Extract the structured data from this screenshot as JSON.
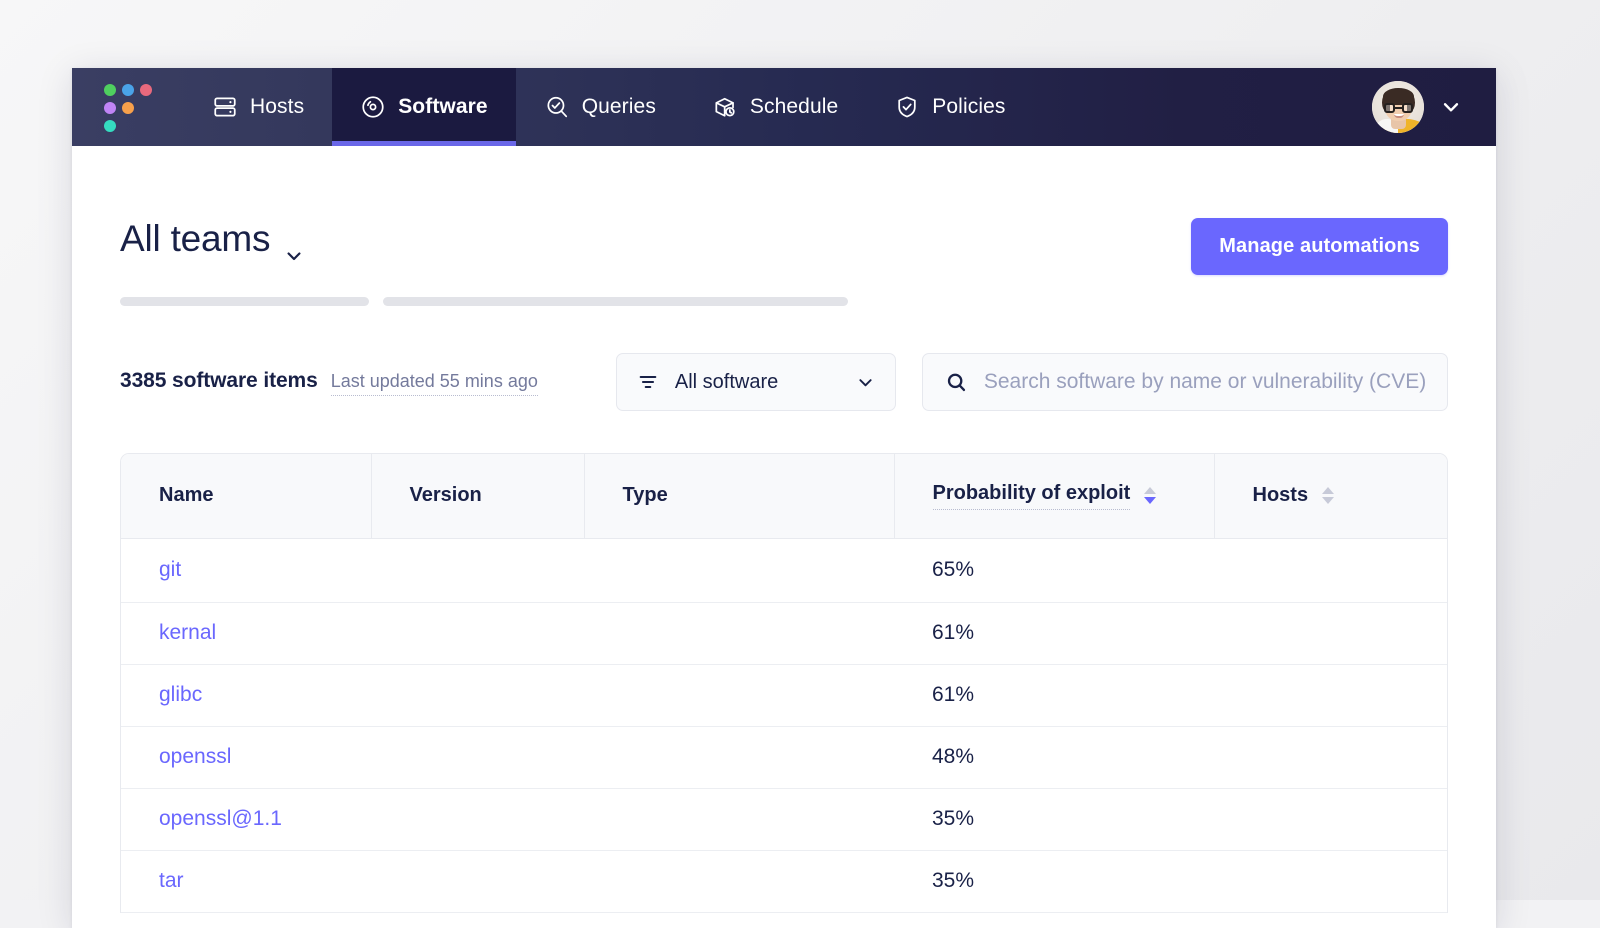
{
  "nav": {
    "logo_name": "fleet-logo",
    "items": [
      {
        "label": "Hosts",
        "icon": "server-icon",
        "active": false
      },
      {
        "label": "Software",
        "icon": "disc-icon",
        "active": true
      },
      {
        "label": "Queries",
        "icon": "search-check-icon",
        "active": false
      },
      {
        "label": "Schedule",
        "icon": "box-clock-icon",
        "active": false
      },
      {
        "label": "Policies",
        "icon": "shield-check-icon",
        "active": false
      }
    ],
    "avatar_alt": "user-avatar",
    "user_menu_icon": "chevron-down-icon"
  },
  "header": {
    "team_title": "All teams",
    "team_chevron_icon": "chevron-down-icon",
    "manage_automations_label": "Manage automations"
  },
  "toolbar": {
    "count_label": "3385 software items",
    "last_updated_label": "Last updated 55 mins ago",
    "filter": {
      "icon": "filter-icon",
      "value": "All software",
      "chevron_icon": "chevron-down-icon"
    },
    "search": {
      "icon": "search-icon",
      "placeholder": "Search software by name or vulnerability (CVE)",
      "value": ""
    }
  },
  "table": {
    "columns": [
      {
        "label": "Name",
        "sortable": false,
        "tooltip": false
      },
      {
        "label": "Version",
        "sortable": false,
        "tooltip": false
      },
      {
        "label": "Type",
        "sortable": false,
        "tooltip": false
      },
      {
        "label": "Probability of exploit",
        "sortable": true,
        "tooltip": true,
        "sort": "desc"
      },
      {
        "label": "Hosts",
        "sortable": true,
        "tooltip": false,
        "sort": "none"
      }
    ],
    "rows": [
      {
        "name": "git",
        "version": "",
        "type": "",
        "probability": "65%",
        "hosts": ""
      },
      {
        "name": "kernal",
        "version": "",
        "type": "",
        "probability": "61%",
        "hosts": ""
      },
      {
        "name": "glibc",
        "version": "",
        "type": "",
        "probability": "61%",
        "hosts": ""
      },
      {
        "name": "openssl",
        "version": "",
        "type": "",
        "probability": "48%",
        "hosts": ""
      },
      {
        "name": "openssl@1.1",
        "version": "",
        "type": "",
        "probability": "35%",
        "hosts": ""
      },
      {
        "name": "tar",
        "version": "",
        "type": "",
        "probability": "35%",
        "hosts": ""
      }
    ]
  },
  "colors": {
    "accent": "#6a67fe",
    "nav_background": "#2e3257",
    "nav_active": "#1b1a40",
    "text_primary": "#192147",
    "text_muted": "#747a9c",
    "skeleton": "#e2e4e9"
  }
}
